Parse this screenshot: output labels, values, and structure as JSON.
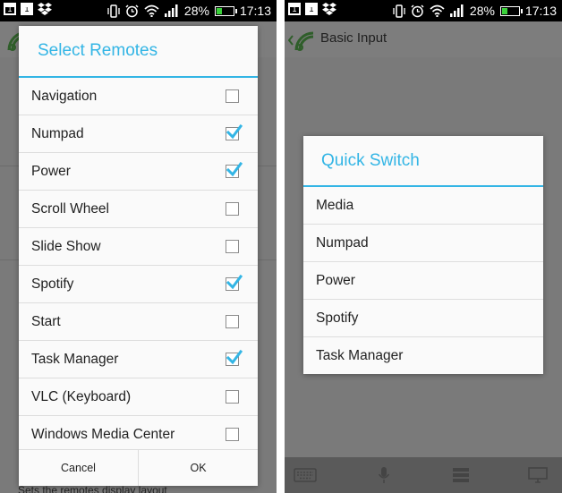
{
  "status_bar": {
    "notif_left_1": "1",
    "notif_left_2": "1",
    "battery_percent": "28%",
    "battery_fill": 0.28,
    "time": "17:13"
  },
  "left_screen": {
    "background_caption": "Sets the remotes display layout",
    "dialog": {
      "title": "Select Remotes",
      "items": [
        {
          "label": "Navigation",
          "checked": false
        },
        {
          "label": "Numpad",
          "checked": true
        },
        {
          "label": "Power",
          "checked": true
        },
        {
          "label": "Scroll Wheel",
          "checked": false
        },
        {
          "label": "Slide Show",
          "checked": false
        },
        {
          "label": "Spotify",
          "checked": true
        },
        {
          "label": "Start",
          "checked": false
        },
        {
          "label": "Task Manager",
          "checked": true
        },
        {
          "label": "VLC (Keyboard)",
          "checked": false
        },
        {
          "label": "Windows Media Center",
          "checked": false
        }
      ],
      "cancel_label": "Cancel",
      "ok_label": "OK"
    }
  },
  "right_screen": {
    "app_title": "Basic Input",
    "dialog": {
      "title": "Quick Switch",
      "items": [
        "Media",
        "Numpad",
        "Power",
        "Spotify",
        "Task Manager"
      ]
    },
    "toolbar_icons": [
      "keyboard-icon",
      "microphone-icon",
      "remote-list-icon",
      "monitor-icon"
    ]
  },
  "colors": {
    "accent": "#33b5e5",
    "check": "#33b5e5",
    "battery": "#3ad13a",
    "logo_green": "#3a9e33"
  }
}
